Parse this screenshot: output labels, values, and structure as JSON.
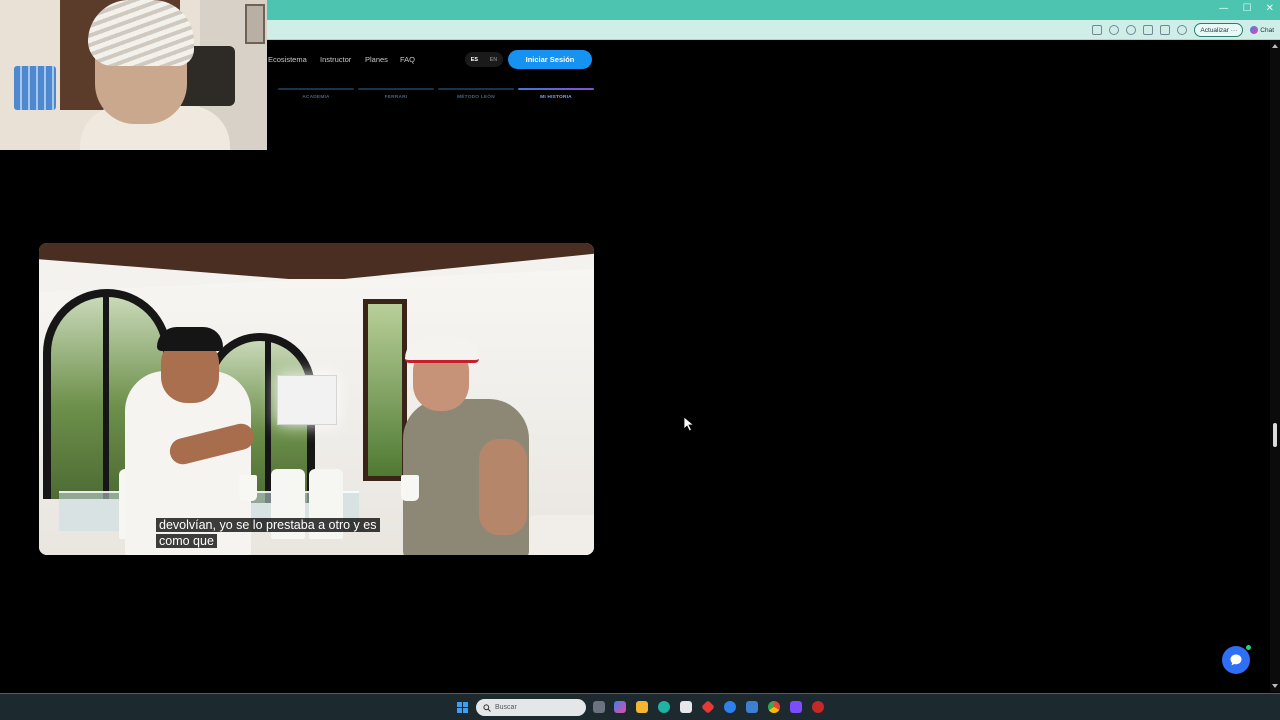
{
  "browser": {
    "update_label": "Actualizar ···",
    "chat_label": "Chat",
    "window_controls": [
      "—",
      "☐",
      "✕"
    ]
  },
  "site_nav": {
    "links": [
      {
        "label": "Ecosistema"
      },
      {
        "label": "Instructor"
      },
      {
        "label": "Planes"
      },
      {
        "label": "FAQ"
      }
    ],
    "lang_es": "ES",
    "lang_en": "EN",
    "login_label": "Iniciar Sesión"
  },
  "steps": [
    {
      "label": "ACADEMIA",
      "active": false
    },
    {
      "label": "FERRARI",
      "active": false
    },
    {
      "label": "MÉTODO LEÓN",
      "active": false
    },
    {
      "label": "MI HISTORIA",
      "active": true
    }
  ],
  "video": {
    "subtitle_line1": "devolvían, yo se lo prestaba a otro y es",
    "subtitle_line2": "como que"
  },
  "taskbar": {
    "search_placeholder": "Buscar"
  },
  "colors": {
    "accent": "#1692f2",
    "chrome": "#4cc4b0",
    "chat_fab": "#2f6ff5"
  }
}
